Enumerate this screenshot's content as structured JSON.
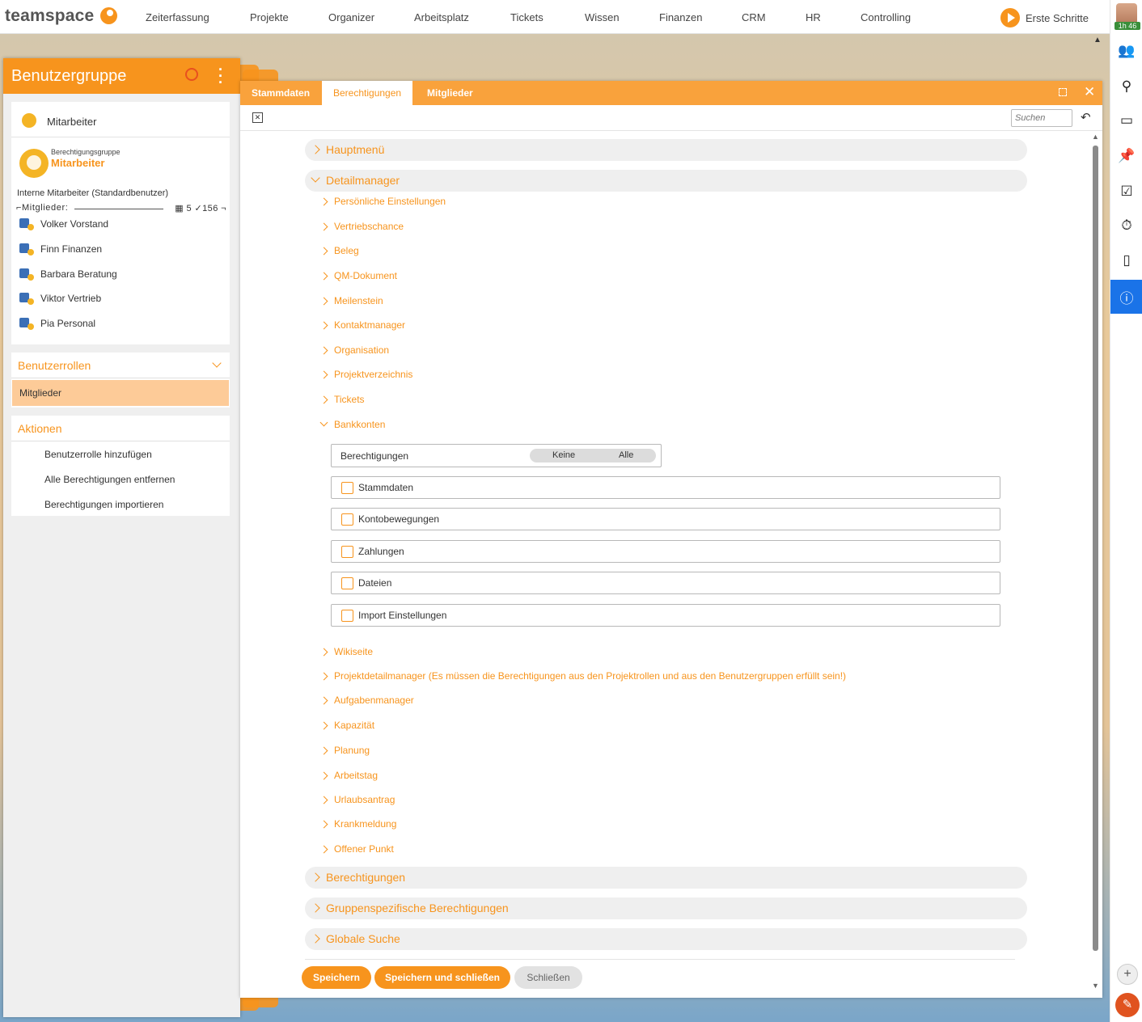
{
  "nav": {
    "logo": "teamspace",
    "items": [
      "Zeiterfassung",
      "Projekte",
      "Organizer",
      "Arbeitsplatz",
      "Tickets",
      "Wissen",
      "Finanzen",
      "CRM",
      "HR",
      "Controlling"
    ],
    "cta": "Erste Schritte",
    "timer": "1h 46"
  },
  "rightbar": {
    "icons": [
      "users-icon",
      "search-icon",
      "inbox-icon",
      "pin-icon",
      "tasks-icon",
      "stopwatch-icon",
      "mobile-icon",
      "info-icon"
    ]
  },
  "left": {
    "title": "Benutzergruppe",
    "group_name": "Mitarbeiter",
    "sub_type": "Berechtigungsgruppe",
    "sub_name": "Mitarbeiter",
    "description": "Interne Mitarbeiter (Standardbenutzer)",
    "members_label": "Mitglieder:",
    "members_count": "5",
    "members_total": "156",
    "members": [
      "Volker Vorstand",
      "Finn Finanzen",
      "Barbara Beratung",
      "Viktor Vertrieb",
      "Pia Personal"
    ],
    "roles_title": "Benutzerrollen",
    "role_selected": "Mitglieder",
    "actions_title": "Aktionen",
    "actions": [
      "Benutzerrolle hinzufügen",
      "Alle Berechtigungen entfernen",
      "Berechtigungen importieren"
    ]
  },
  "dialog": {
    "tabs": [
      "Stammdaten",
      "Berechtigungen",
      "Mitglieder"
    ],
    "active_tab": "Berechtigungen",
    "search_placeholder": "Suchen",
    "sections": {
      "hauptmenu": "Hauptmenü",
      "detailmanager": "Detailmanager",
      "berechtigungen": "Berechtigungen",
      "gruppen": "Gruppenspezifische Berechtigungen",
      "suche": "Globale Suche"
    },
    "detail_items_before": [
      "Persönliche Einstellungen",
      "Vertriebschance",
      "Beleg",
      "QM-Dokument",
      "Meilenstein",
      "Kontaktmanager",
      "Organisation",
      "Projektverzeichnis",
      "Tickets"
    ],
    "expanded_item": "Bankkonten",
    "perm_label": "Berechtigungen",
    "toggle": {
      "none": "Keine",
      "all": "Alle"
    },
    "checkboxes": [
      {
        "label": "Stammdaten",
        "checked": false
      },
      {
        "label": "Kontobewegungen",
        "checked": false
      },
      {
        "label": "Zahlungen",
        "checked": false
      },
      {
        "label": "Dateien",
        "checked": false
      },
      {
        "label": "Import Einstellungen",
        "checked": false
      }
    ],
    "detail_items_after": [
      "Wikiseite",
      "Projektdetailmanager (Es müssen die Berechtigungen aus den Projektrollen und aus den Benutzergruppen erfüllt sein!)",
      "Aufgabenmanager",
      "Kapazität",
      "Planung",
      "Arbeitstag",
      "Urlaubsantrag",
      "Krankmeldung",
      "Offener Punkt"
    ],
    "buttons": {
      "save": "Speichern",
      "save_close": "Speichern und schließen",
      "close": "Schließen"
    }
  },
  "colors": {
    "accent": "#f7941d",
    "info": "#1a73e8"
  }
}
